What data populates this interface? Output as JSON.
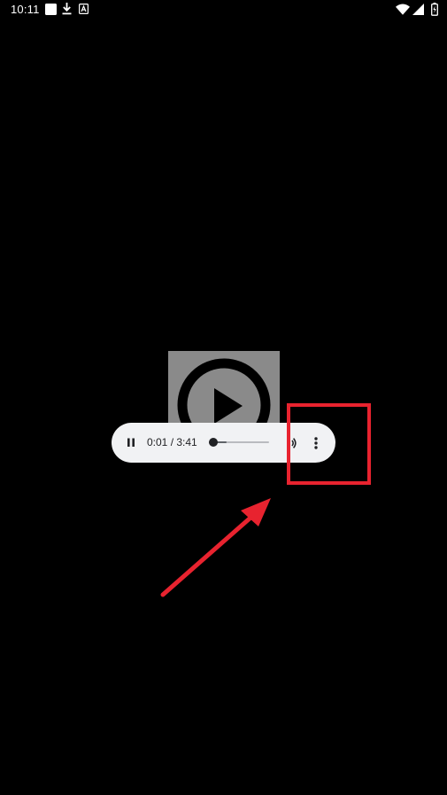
{
  "status_bar": {
    "time": "10:11",
    "left_icons": [
      "square-notification-icon",
      "download-icon",
      "text-a-icon"
    ],
    "right_icons": [
      "wifi-icon",
      "signal-icon",
      "battery-icon"
    ]
  },
  "video": {
    "thumbnail_icon": "play-circle-icon",
    "thumbnail_color": "#8a8a8a"
  },
  "player": {
    "play_state_icon": "pause-icon",
    "current_time": "0:01",
    "separator": " / ",
    "duration": "3:41",
    "playback_fraction": 0.0045,
    "buffered_fraction": 0.3,
    "volume_icon": "volume-icon",
    "menu_icon": "more-vert-icon",
    "background_color": "#f1f2f4"
  },
  "annotation": {
    "highlight_color": "#e8232f",
    "target": "more-options-button"
  }
}
